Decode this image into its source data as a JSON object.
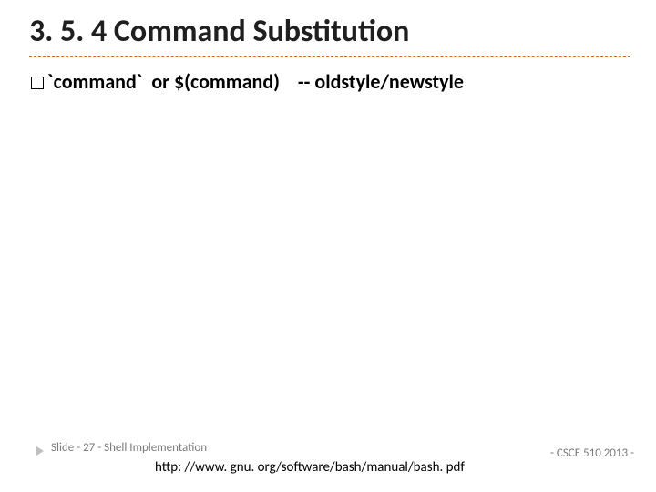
{
  "title": "3. 5. 4 Command Substitution",
  "body": {
    "line1_part1": "`command`",
    "line1_part2": "  or $(command)",
    "line1_part3": "    -- oldstyle/newstyle"
  },
  "footer": {
    "slide_label": "Slide - 27 -  Shell Implementation",
    "url": "http: //www. gnu. org/software/bash/manual/bash. pdf",
    "course": " - CSCE 510 2013 -"
  }
}
